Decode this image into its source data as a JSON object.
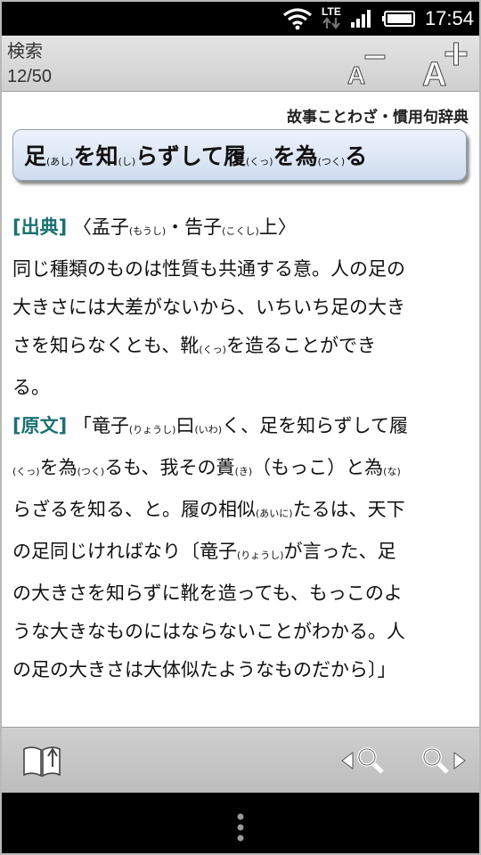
{
  "status_bar": {
    "network": "LTE",
    "time": "17:54",
    "icons": [
      "wifi-icon",
      "lte-data-icon",
      "signal-icon",
      "battery-icon"
    ]
  },
  "action_bar": {
    "title": "検索",
    "count": "12/50",
    "font_decrease_icon": "font-decrease-icon",
    "font_increase_icon": "font-increase-icon"
  },
  "entry": {
    "dictionary": "故事ことわざ・慣用句辞典",
    "headword": [
      {
        "t": "足"
      },
      {
        "r": "(あし)"
      },
      {
        "t": "を知"
      },
      {
        "r": "(し)"
      },
      {
        "t": "らずして履"
      },
      {
        "r": "(くっ)"
      },
      {
        "t": "を為"
      },
      {
        "r": "(つく)"
      },
      {
        "t": "る"
      }
    ],
    "source_label": "[出典]",
    "source": [
      {
        "t": "〈孟子"
      },
      {
        "r": "(もうし)"
      },
      {
        "t": "・告子"
      },
      {
        "r": "(こくし)"
      },
      {
        "t": "上〉"
      }
    ],
    "meaning": "同じ種類のものは性質も共通する意。人の足の大きさには大差がないから、いちいち足の大きさを知らなくとも、靴(くっ)を造ることができる。",
    "meaning_lines": [
      [
        {
          "t": "同じ種類のものは性質も共通する意。人の足の"
        }
      ],
      [
        {
          "t": "大きさには大差がないから、いちいち足の大き"
        }
      ],
      [
        {
          "t": "さを知らなくとも、靴"
        },
        {
          "r": "(くっ)"
        },
        {
          "t": "を造ることができ"
        }
      ],
      [
        {
          "t": "る。"
        }
      ]
    ],
    "original_label": "[原文]",
    "original_lines": [
      [
        {
          "t": "「竜子"
        },
        {
          "r": "(りょうし)"
        },
        {
          "t": "曰"
        },
        {
          "r": "(いわ)"
        },
        {
          "t": "く、足を知らずして履"
        }
      ],
      [
        {
          "r": "(くっ)"
        },
        {
          "t": "を為"
        },
        {
          "r": "(つく)"
        },
        {
          "t": "るも、我その蕢"
        },
        {
          "r": "(き)"
        },
        {
          "t": "（もっこ）と為"
        },
        {
          "r": "(な)"
        }
      ],
      [
        {
          "t": "らざるを知る、と。履の相似"
        },
        {
          "r": "(あいに)"
        },
        {
          "t": "たるは、天下"
        }
      ],
      [
        {
          "t": "の足同じければなり〔竜子"
        },
        {
          "r": "(りょうし)"
        },
        {
          "t": "が言った、足"
        }
      ],
      [
        {
          "t": "の大きさを知らずに靴を造っても、もっこのよ"
        }
      ],
      [
        {
          "t": "うな大きなものにはならないことがわかる。人"
        }
      ],
      [
        {
          "t": "の足の大きさは大体似たようなものだから〕」"
        }
      ]
    ]
  },
  "toolbar": {
    "book_icon": "dictionary-book-icon",
    "prev_icon": "search-previous-icon",
    "next_icon": "search-next-icon"
  },
  "nav_bar": {
    "menu_icon": "overflow-menu-icon"
  }
}
